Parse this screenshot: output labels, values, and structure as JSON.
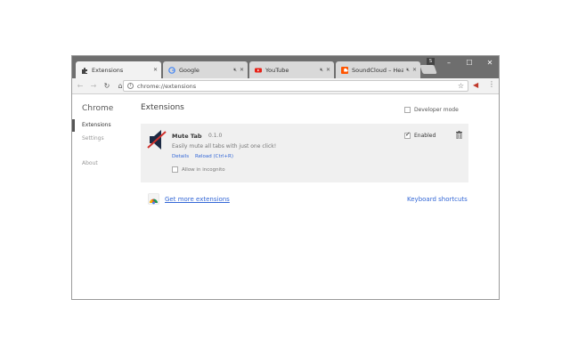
{
  "browser": {
    "tabs": [
      {
        "label": "Extensions",
        "favicon": "puzzle-icon",
        "active": true
      },
      {
        "label": "Google",
        "favicon": "google-icon",
        "active": false
      },
      {
        "label": "YouTube",
        "favicon": "youtube-icon",
        "active": false
      },
      {
        "label": "SoundCloud – Hear t",
        "favicon": "soundcloud-icon",
        "active": false
      }
    ],
    "profile_badge": "S",
    "url": "chrome://extensions",
    "window_controls": {
      "minimize": "–",
      "maximize": "☐",
      "close": "✕"
    }
  },
  "sidebar": {
    "title": "Chrome",
    "items": [
      {
        "label": "Extensions",
        "active": true
      },
      {
        "label": "Settings",
        "active": false
      },
      {
        "label": "About",
        "active": false
      }
    ]
  },
  "main": {
    "title": "Extensions",
    "developer_mode_label": "Developer mode",
    "extension": {
      "name": "Mute Tab",
      "version": "0.1.0",
      "description": "Easily mute all tabs with just one click!",
      "details_link": "Details",
      "reload_link": "Reload (Ctrl+R)",
      "incognito_label": "Allow in incognito",
      "enabled_label": "Enabled",
      "enabled": true
    },
    "get_more_link": "Get more extensions",
    "keyboard_shortcuts_link": "Keyboard shortcuts"
  },
  "colors": {
    "link": "#3367d6",
    "titlebar": "#6e6e6e",
    "card_bg": "#f0f0f0"
  }
}
